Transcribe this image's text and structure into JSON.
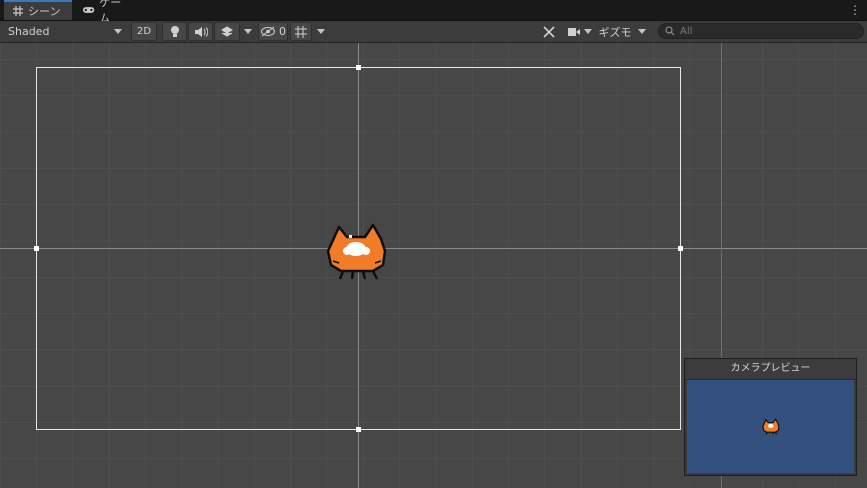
{
  "tabs": [
    {
      "label": "シーン",
      "icon": "grid-icon",
      "active": true
    },
    {
      "label": "ゲーム",
      "icon": "gamepad-icon",
      "active": false
    }
  ],
  "toolbar": {
    "shading_mode": "Shaded",
    "mode_2d_label": "2D",
    "hidden_count": "0",
    "gizmos_label": "ギズモ",
    "search_placeholder": "All"
  },
  "preview": {
    "title": "カメラプレビュー",
    "background_color": "#34507e"
  },
  "colors": {
    "scene_background": "#474747",
    "accent": "#3a79bb",
    "sprite_orange": "#f07c2a"
  }
}
